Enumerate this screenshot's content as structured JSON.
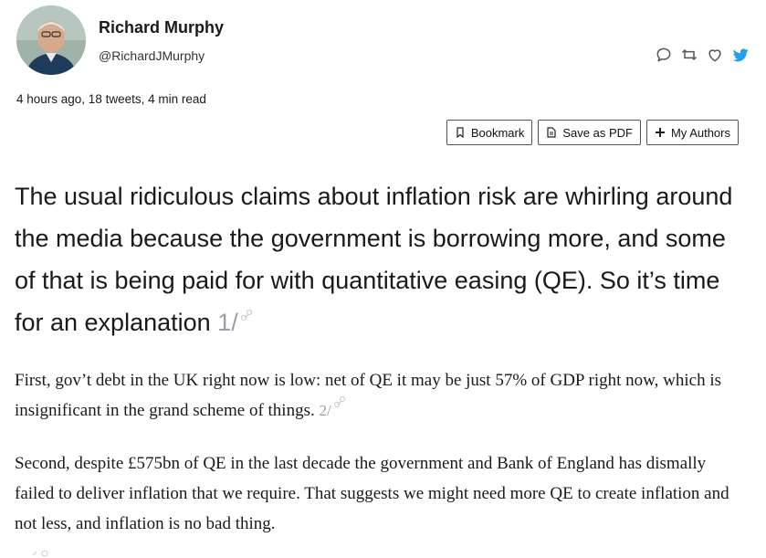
{
  "author": {
    "name": "Richard Murphy",
    "handle": "@RichardJMurphy"
  },
  "meta": "4 hours ago, 18 tweets, 4 min read",
  "actions": {
    "icons": [
      "reply-icon",
      "retweet-icon",
      "like-icon",
      "twitter-bird-icon"
    ],
    "accent": "#1da1f2"
  },
  "buttons": {
    "bookmark": "Bookmark",
    "save_pdf": "Save as PDF",
    "my_authors": "My Authors"
  },
  "tweets": [
    {
      "text": "The usual ridiculous claims about inflation risk are whirling around the media because the government is borrowing more, and some of that is being paid for with quantitative easing (QE). So it’s time for an explanation",
      "num": "1/"
    },
    {
      "text": "First, gov’t debt in the UK right now is low: net of QE it may be just 57% of GDP right now, which is insignificant in the grand scheme of things.",
      "num": "2/"
    },
    {
      "text": "Second, despite £575bn of QE in the last decade the government and Bank of England has dismally failed to deliver inflation that we require. That suggests we might need more QE to create inflation and not less, and inflation is no bad thing.",
      "num": ""
    }
  ]
}
